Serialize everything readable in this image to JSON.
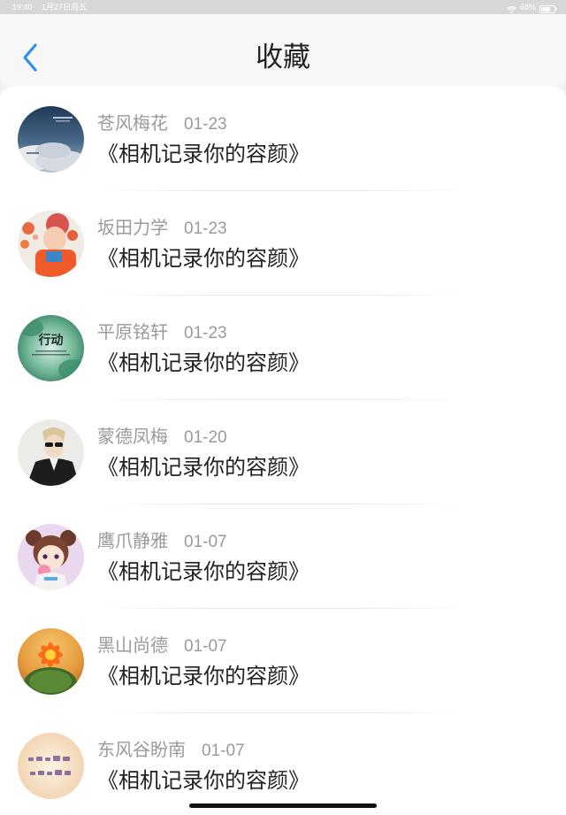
{
  "status_bar": {
    "time": "19:40",
    "date": "1月27日周五",
    "battery": "68%",
    "wifi_icon": "wifi-icon",
    "battery_icon": "battery-icon"
  },
  "nav": {
    "back_icon": "chevron-left-icon",
    "title": "收藏",
    "accent_color": "#2f8ef2"
  },
  "list": {
    "items": [
      {
        "author": "苍风梅花",
        "date": "01-23",
        "title": "《相机记录你的容颜》",
        "avatar": "cloudy-sky-avatar"
      },
      {
        "author": "坂田力学",
        "date": "01-23",
        "title": "《相机记录你的容颜》",
        "avatar": "child-with-flowers-avatar"
      },
      {
        "author": "平原铭轩",
        "date": "01-23",
        "title": "《相机记录你的容颜》",
        "avatar": "green-action-poster-avatar",
        "avatar_text": "行动"
      },
      {
        "author": "蒙德凤梅",
        "date": "01-20",
        "title": "《相机记录你的容颜》",
        "avatar": "man-with-sunglasses-avatar"
      },
      {
        "author": "鹰爪静雅",
        "date": "01-07",
        "title": "《相机记录你的容颜》",
        "avatar": "anime-girl-avatar"
      },
      {
        "author": "黑山尚德",
        "date": "01-07",
        "title": "《相机记录你的容颜》",
        "avatar": "cactus-flower-avatar"
      },
      {
        "author": "东风谷盼南",
        "date": "01-07",
        "title": "《相机记录你的容颜》",
        "avatar": "calligraphy-avatar"
      }
    ]
  }
}
